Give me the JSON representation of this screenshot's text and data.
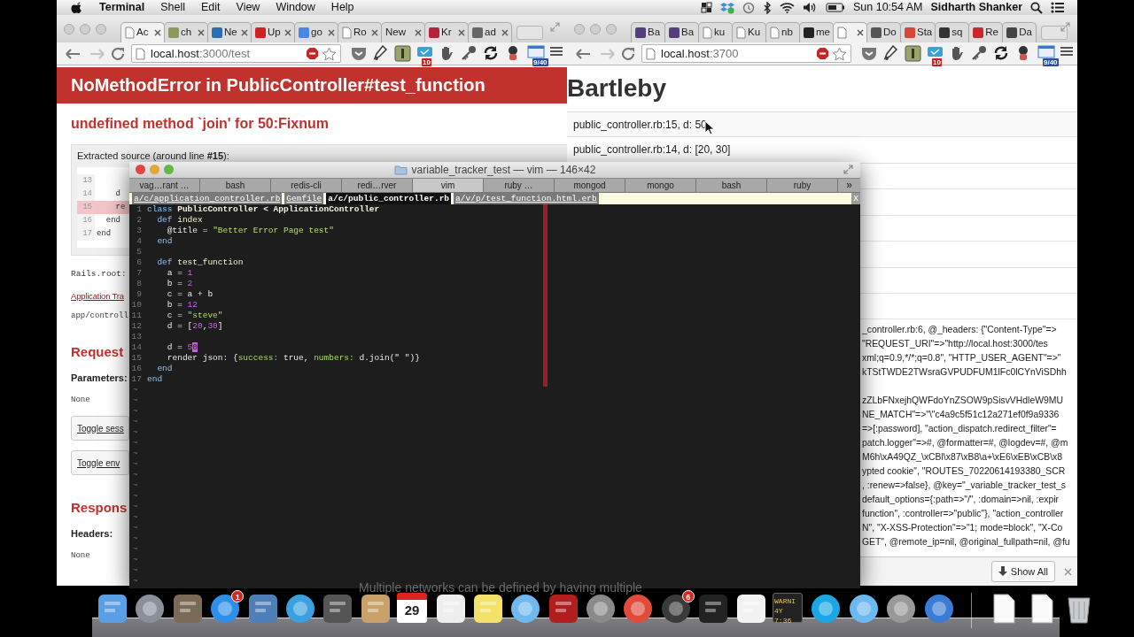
{
  "menu_bar": {
    "app": "Terminal",
    "menus": [
      "Shell",
      "Edit",
      "View",
      "Window",
      "Help"
    ],
    "clock": "Sun 10:54 AM",
    "user": "Sidharth Shanker"
  },
  "left_browser": {
    "tabs": [
      {
        "label": "Ac",
        "selected": true,
        "closable": true,
        "kind": "page"
      },
      {
        "label": "ch",
        "selected": false,
        "closable": true,
        "kind": "square",
        "color": "#8a9a5a"
      },
      {
        "label": "Ne",
        "selected": false,
        "closable": true,
        "kind": "square",
        "color": "#2a6fb0"
      },
      {
        "label": "Up",
        "selected": false,
        "closable": true,
        "kind": "square",
        "color": "#cc2222"
      },
      {
        "label": "go",
        "selected": false,
        "closable": true,
        "kind": "square",
        "color": "#4a86e8"
      },
      {
        "label": "Ro",
        "selected": false,
        "closable": true,
        "kind": "page"
      },
      {
        "label": "New",
        "selected": false,
        "closable": true,
        "kind": "none"
      },
      {
        "label": "Kr",
        "selected": false,
        "closable": true,
        "kind": "square",
        "color": "#b3223a"
      },
      {
        "label": "ad",
        "selected": false,
        "closable": true,
        "kind": "square",
        "color": "#666666"
      }
    ],
    "url_host": "local.host",
    "url_path": ":3000/test",
    "mail_badge": "10",
    "calendar_badge": "9/40",
    "error_title": "NoMethodError in PublicController#test_function",
    "error_message": "undefined method `join' for 50:Fixnum",
    "source_label": "Extracted source (around line **#15**):",
    "source_lines": [
      {
        "number": "13",
        "highlighted": false
      },
      {
        "number": "14",
        "code": "    d",
        "highlighted": false
      },
      {
        "number": "15",
        "code": "    re",
        "highlighted": true
      },
      {
        "number": "16",
        "code": "  end",
        "highlighted": false
      },
      {
        "number": "17",
        "code": "end",
        "highlighted": false
      }
    ],
    "rails_root": "Rails.root:",
    "trace_link": "Application Tra",
    "trace_path": "app/controll",
    "request_heading": "Request",
    "parameters_label": "Parameters:",
    "parameters_value": "None",
    "toggle_buttons": [
      "Toggle sess",
      "Toggle env"
    ],
    "response_heading": "Respons",
    "headers_label": "Headers:",
    "headers_value": "None"
  },
  "right_browser": {
    "tabs": [
      {
        "label": "Ba",
        "selected": false,
        "closable": false,
        "kind": "square",
        "color": "#563d7c"
      },
      {
        "label": "Ba",
        "selected": false,
        "closable": false,
        "kind": "square",
        "color": "#563d7c"
      },
      {
        "label": "ku",
        "selected": false,
        "closable": false,
        "kind": "page"
      },
      {
        "label": "Ku",
        "selected": false,
        "closable": false,
        "kind": "page"
      },
      {
        "label": "nb",
        "selected": false,
        "closable": false,
        "kind": "page"
      },
      {
        "label": "me",
        "selected": false,
        "closable": false,
        "kind": "square",
        "color": "#222222"
      },
      {
        "selected": true,
        "closable": true,
        "kind": "page"
      },
      {
        "label": "Do",
        "selected": false,
        "closable": false,
        "kind": "square",
        "color": "#555555"
      },
      {
        "label": "Sta",
        "selected": false,
        "closable": false,
        "kind": "square",
        "color": "#d44638"
      },
      {
        "label": "sq",
        "selected": false,
        "closable": false,
        "kind": "square",
        "color": "#333333"
      },
      {
        "label": "Re",
        "selected": false,
        "closable": false,
        "kind": "square",
        "color": "#c8282d"
      },
      {
        "label": "Da",
        "selected": false,
        "closable": false,
        "kind": "square",
        "color": "#444444"
      }
    ],
    "url_host": "local.host",
    "url_path": ":3700",
    "mail_badge": "10",
    "calendar_badge": "9/40",
    "heading": "Bartleby",
    "log_rows": [
      "public_controller.rb:15, d: 50",
      "public_controller.rb:14, d: [20, 30]"
    ],
    "log_tail": [
      {
        "kind": "text",
        "text": "_controller.rb:6, @_headers: {\"Content-Type\"=>"
      },
      {
        "kind": "text",
        "text": "\"REQUEST_URI\"=>\"http://local.host:3000/tes"
      },
      {
        "kind": "text",
        "text": "xml;q=0.9,*/*;q=0.8\", \"HTTP_USER_AGENT\"=>\""
      },
      {
        "kind": "text",
        "text": "kTStTWDE2TWsraGVPUDFUM1lFc0lCYnViSDhh"
      },
      {
        "kind": "blank"
      },
      {
        "kind": "text",
        "text": "zZLbFNxejhQWFdoYnZSOW9pSisvVHdleW9MU"
      },
      {
        "kind": "text",
        "text": "NE_MATCH\"=>\"\\\"c4a9c5f51c12a271ef0f9a9336"
      },
      {
        "kind": "text",
        "text": "=>[:password], \"action_dispatch.redirect_filter\"="
      },
      {
        "kind": "text",
        "text": "patch.logger\"=>#, @formatter=#, @logdev=#, @m"
      },
      {
        "kind": "text",
        "text": "M6h\\xA49QZ_\\xCBl\\x87\\xB8\\a+\\xE6\\xEB\\xCB\\x8"
      },
      {
        "kind": "text",
        "text": "ypted cookie\", \"ROUTES_70220614193380_SCR"
      },
      {
        "kind": "text",
        "text": ", :renew=>false}, @key=\"_variable_tracker_test_s"
      },
      {
        "kind": "text",
        "text": "default_options={:path=>\"/\", :domain=>nil, :expir"
      },
      {
        "kind": "text",
        "text": "function\", :controller=>\"public\"}, \"action_controller"
      },
      {
        "kind": "text",
        "text": "N\", \"X-XSS-Protection\"=>\"1; mode=block\", \"X-Co"
      },
      {
        "kind": "text",
        "text": "GET\", @remote_ip=nil, @original_fullpath=nil, @fu"
      }
    ],
    "download_button": "Show All"
  },
  "terminal": {
    "title": "variable_tracker_test — vim — 146×42",
    "tabs": [
      {
        "label": "vag…rant …",
        "selected": false
      },
      {
        "label": "bash",
        "selected": false
      },
      {
        "label": "redis-cli",
        "selected": false
      },
      {
        "label": "redi…rver",
        "selected": false
      },
      {
        "label": "vim",
        "selected": true
      },
      {
        "label": "ruby …",
        "selected": false
      },
      {
        "label": "mongod",
        "selected": false
      },
      {
        "label": "mongo",
        "selected": false
      },
      {
        "label": "bash",
        "selected": false
      },
      {
        "label": "ruby",
        "selected": false
      }
    ],
    "more": "»",
    "vim_tabs": [
      {
        "label": "a/c/application_controller.rb",
        "selected": false
      },
      {
        "label": "Gemfile",
        "selected": false
      },
      {
        "label": "a/c/public_controller.rb",
        "selected": true
      },
      {
        "label": "a/v/p/test_function.html.erb",
        "selected": false
      }
    ],
    "vim_close": "X",
    "code": [
      {
        "number": "1",
        "tokens": [
          {
            "text": "class",
            "kind": "kw"
          },
          {
            "text": " PublicController < ApplicationController",
            "kind": "const"
          }
        ]
      },
      {
        "number": "2",
        "tokens": [
          {
            "text": "  def",
            "kind": "kw"
          },
          {
            "text": " index",
            "kind": "fn"
          }
        ]
      },
      {
        "number": "3",
        "tokens": [
          {
            "text": "    @title = ",
            "kind": "plain"
          },
          {
            "text": "\"Better Error Page test\"",
            "kind": "str"
          }
        ]
      },
      {
        "number": "4",
        "tokens": [
          {
            "text": "  end",
            "kind": "kw"
          }
        ]
      },
      {
        "number": "5"
      },
      {
        "number": "6",
        "tokens": [
          {
            "text": "  def",
            "kind": "kw"
          },
          {
            "text": " test_function",
            "kind": "fn"
          }
        ]
      },
      {
        "number": "7",
        "tokens": [
          {
            "text": "    a = ",
            "kind": "plain"
          },
          {
            "text": "1",
            "kind": "num"
          }
        ]
      },
      {
        "number": "8",
        "tokens": [
          {
            "text": "    b = ",
            "kind": "plain"
          },
          {
            "text": "2",
            "kind": "num"
          }
        ]
      },
      {
        "number": "9",
        "tokens": [
          {
            "text": "    c = a + b",
            "kind": "plain"
          }
        ]
      },
      {
        "number": "10",
        "tokens": [
          {
            "text": "    b = ",
            "kind": "plain"
          },
          {
            "text": "12",
            "kind": "num"
          }
        ]
      },
      {
        "number": "11",
        "tokens": [
          {
            "text": "    c = ",
            "kind": "plain"
          },
          {
            "text": "\"steve\"",
            "kind": "str"
          }
        ]
      },
      {
        "number": "12",
        "tokens": [
          {
            "text": "    d = [",
            "kind": "plain"
          },
          {
            "text": "20",
            "kind": "num"
          },
          {
            "text": ",",
            "kind": "plain"
          },
          {
            "text": "30",
            "kind": "num"
          },
          {
            "text": "]",
            "kind": "plain"
          }
        ]
      },
      {
        "number": "13"
      },
      {
        "number": "14",
        "tokens": [
          {
            "text": "    d = ",
            "kind": "plain"
          },
          {
            "text": "5",
            "kind": "num"
          },
          {
            "text": "0",
            "kind": "cursor"
          }
        ]
      },
      {
        "number": "15",
        "tokens": [
          {
            "text": "    render json: {",
            "kind": "plain"
          },
          {
            "text": "success:",
            "kind": "sym"
          },
          {
            "text": " true, ",
            "kind": "plain"
          },
          {
            "text": "numbers:",
            "kind": "sym"
          },
          {
            "text": " d.join(\" \")}",
            "kind": "plain"
          }
        ]
      },
      {
        "number": "16",
        "tokens": [
          {
            "text": "  end",
            "kind": "kw"
          }
        ]
      },
      {
        "number": "17",
        "tokens": [
          {
            "text": "end",
            "kind": "kw"
          }
        ]
      }
    ],
    "empty_lines": [
      "~",
      "~",
      "~",
      "~",
      "~",
      "~",
      "~",
      "~",
      "~",
      "~",
      "~",
      "~",
      "~",
      "~",
      "~",
      "~",
      "~",
      "~",
      "~"
    ]
  },
  "dock_note": "Multiple networks can be defined by having multiple",
  "dock": [
    {
      "kind": "square",
      "color": "#5a9fe6"
    },
    {
      "kind": "circle",
      "color": "#8a8f99"
    },
    {
      "kind": "square",
      "color": "#7b6a55"
    },
    {
      "kind": "circle",
      "color": "#2d8fe8",
      "badge": "1"
    },
    {
      "kind": "square",
      "color": "#4e7fb8"
    },
    {
      "kind": "circle",
      "color": "#3aa0e0"
    },
    {
      "kind": "square",
      "color": "#555555"
    },
    {
      "kind": "square",
      "color": "#c9a26a"
    },
    {
      "kind": "calendar",
      "text": "29"
    },
    {
      "kind": "square",
      "color": "#eeeeee"
    },
    {
      "kind": "square",
      "color": "#f3e16a"
    },
    {
      "kind": "circle",
      "color": "#6fb8f0"
    },
    {
      "kind": "square",
      "color": "#b01e1e"
    },
    {
      "kind": "circle",
      "color": "#8a8a8a"
    },
    {
      "kind": "circle",
      "color": "#e24a3b"
    },
    {
      "kind": "circle",
      "color": "#3a3a3a",
      "badge": "6"
    },
    {
      "kind": "square",
      "color": "#222222"
    },
    {
      "kind": "square",
      "color": "#f2f2f2"
    },
    {
      "kind": "console",
      "lines": [
        "WARNI",
        "4Y 7:36"
      ]
    },
    {
      "kind": "circle",
      "color": "#19a8e5"
    },
    {
      "kind": "circle",
      "color": "#6cb8f0"
    },
    {
      "kind": "circle",
      "color": "#999999"
    },
    {
      "kind": "circle",
      "color": "#3a7bd5"
    },
    {
      "kind": "separator"
    },
    {
      "kind": "doc"
    },
    {
      "kind": "doc"
    },
    {
      "kind": "trash"
    }
  ]
}
